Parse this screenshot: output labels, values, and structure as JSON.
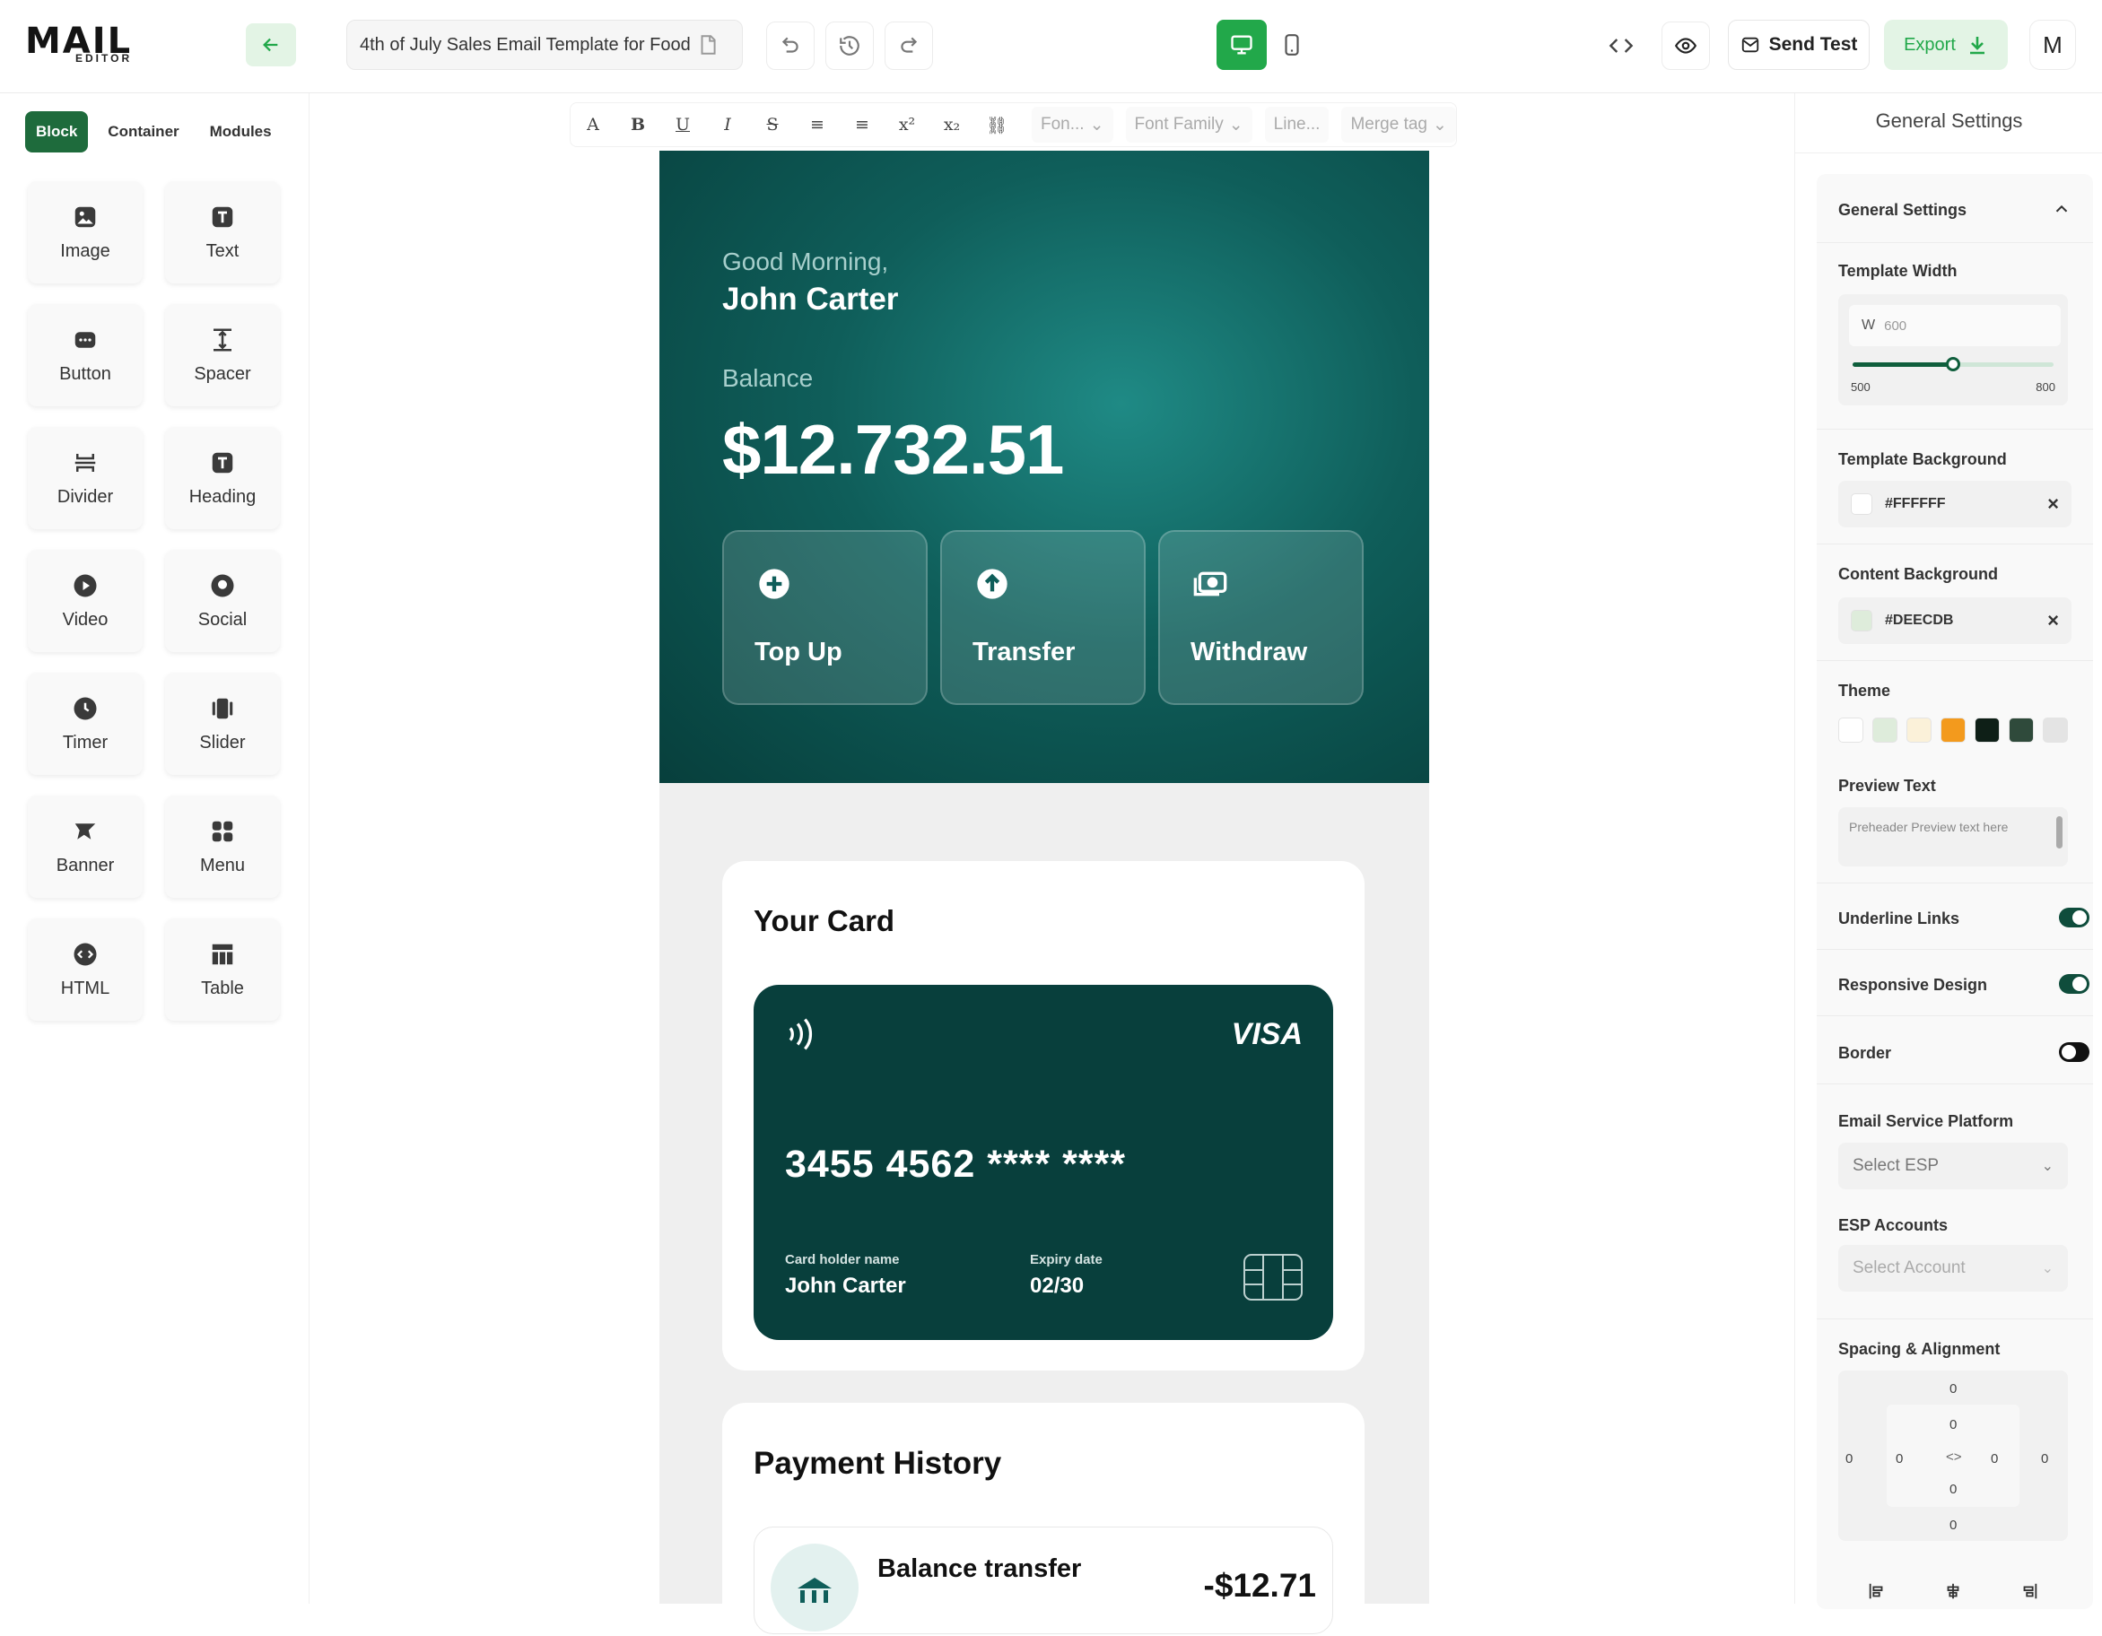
{
  "app": {
    "logo_main": "MAIL",
    "logo_sub": "EDITOR"
  },
  "header": {
    "doc_title": "4th of July Sales Email Template for Food",
    "send_test_label": "Send Test",
    "export_label": "Export",
    "avatar_initial": "M"
  },
  "left_panel": {
    "tabs": [
      {
        "label": "Block"
      },
      {
        "label": "Container"
      },
      {
        "label": "Modules"
      }
    ],
    "blocks": [
      {
        "label": "Image",
        "icon": "image-icon"
      },
      {
        "label": "Text",
        "icon": "text-icon"
      },
      {
        "label": "Button",
        "icon": "button-icon"
      },
      {
        "label": "Spacer",
        "icon": "spacer-icon"
      },
      {
        "label": "Divider",
        "icon": "divider-icon"
      },
      {
        "label": "Heading",
        "icon": "heading-icon"
      },
      {
        "label": "Video",
        "icon": "video-icon"
      },
      {
        "label": "Social",
        "icon": "social-icon"
      },
      {
        "label": "Timer",
        "icon": "timer-icon"
      },
      {
        "label": "Slider",
        "icon": "slider-icon"
      },
      {
        "label": "Banner",
        "icon": "banner-icon"
      },
      {
        "label": "Menu",
        "icon": "menu-icon"
      },
      {
        "label": "HTML",
        "icon": "html-icon"
      },
      {
        "label": "Table",
        "icon": "table-icon"
      }
    ]
  },
  "format_bar": {
    "buttons": [
      "A",
      "B",
      "U",
      "I",
      "S",
      "≡",
      "≡",
      "x²",
      "x₂",
      "⛓"
    ],
    "font_size": "Fon...",
    "font_family": "Font Family",
    "line_height": "Line...",
    "merge_tag": "Merge tag"
  },
  "email": {
    "greeting": "Good Morning,",
    "user_name": "John Carter",
    "balance_label": "Balance",
    "balance_value": "$12.732.51",
    "actions": [
      {
        "label": "Top Up"
      },
      {
        "label": "Transfer"
      },
      {
        "label": "Withdraw"
      }
    ],
    "card_section_title": "Your Card",
    "card": {
      "brand": "VISA",
      "number": "3455 4562 **** ****",
      "holder_label": "Card holder name",
      "holder_value": "John Carter",
      "expiry_label": "Expiry date",
      "expiry_value": "02/30"
    },
    "payment_title": "Payment History",
    "payments": [
      {
        "title": "Balance transfer",
        "amount": "-$12.71"
      }
    ]
  },
  "settings": {
    "panel_title": "General Settings",
    "section_title": "General Settings",
    "template_width_label": "Template Width",
    "width_prefix": "W",
    "width_value": "600",
    "width_min": "500",
    "width_max": "800",
    "width_slider_level": 0.5,
    "template_bg_label": "Template Background",
    "template_bg_value": "#FFFFFF",
    "content_bg_label": "Content Background",
    "content_bg_value": "#DEECDB",
    "theme_label": "Theme",
    "theme_colors": [
      "#FFFFFF",
      "#DEECDB",
      "#FBF1D9",
      "#F39A1D",
      "#0E1F17",
      "#2F4A3B",
      "#E4E4E4"
    ],
    "preview_text_label": "Preview Text",
    "preview_text_placeholder": "Preheader Preview text here",
    "underline_links_label": "Underline Links",
    "underline_links_on": true,
    "responsive_label": "Responsive Design",
    "responsive_on": true,
    "border_label": "Border",
    "border_on": false,
    "esp_label": "Email Service Platform",
    "esp_placeholder": "Select ESP",
    "esp_accounts_label": "ESP Accounts",
    "account_placeholder": "Select Account",
    "spacing_label": "Spacing & Alignment",
    "spacing_values": [
      "0",
      "0",
      "0",
      "0",
      "0",
      "0",
      "0",
      "0",
      "0",
      "0"
    ]
  },
  "colors": {
    "accent": "#22A84A",
    "hero": "#0F5E5A",
    "card": "#083F3C"
  }
}
